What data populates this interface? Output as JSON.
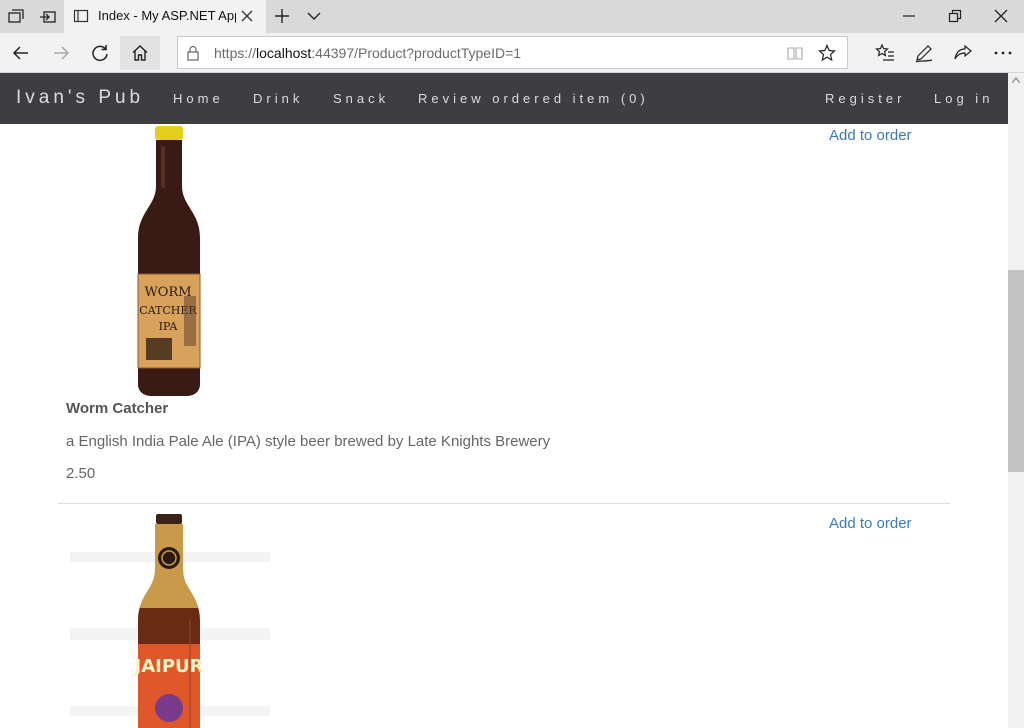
{
  "browser": {
    "tab_title": "Index - My ASP.NET App",
    "url_prefix": "https://",
    "url_host": "localhost",
    "url_path": ":44397/Product?productTypeID=1",
    "icons": [
      "tab-actions-icon",
      "set-aside-tabs-icon",
      "page-icon",
      "close-tab-icon",
      "new-tab-icon",
      "tab-preview-icon",
      "minimize-icon",
      "restore-icon",
      "close-window-icon",
      "back-icon",
      "forward-icon",
      "refresh-icon",
      "home-icon",
      "lock-icon",
      "reading-view-icon",
      "favorite-star-icon",
      "favorites-icon",
      "notes-icon",
      "share-icon",
      "more-icon"
    ]
  },
  "site": {
    "brand": "Ivan's Pub",
    "nav": {
      "home": "Home",
      "drink": "Drink",
      "snack": "Snack",
      "review": "Review ordered item (0)",
      "register": "Register",
      "login": "Log in"
    },
    "colors": {
      "navbar": "#3e3e42",
      "link": "#3b7ab5",
      "text": "#666666"
    }
  },
  "products": [
    {
      "add_label": "Add to order",
      "name": "Worm Catcher",
      "description": "a English India Pale Ale (IPA) style beer brewed by Late Knights Brewery",
      "price": "2.50"
    },
    {
      "add_label": "Add to order"
    }
  ]
}
